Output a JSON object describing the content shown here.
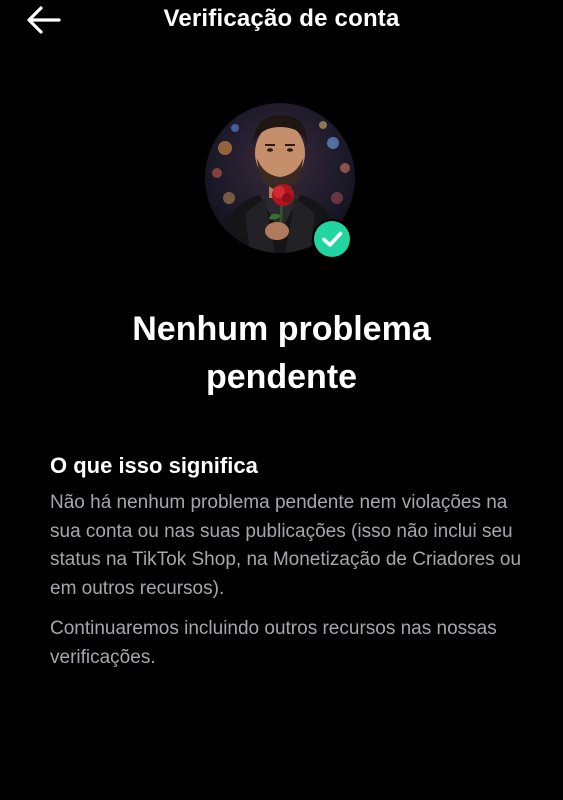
{
  "header": {
    "title": "Verificação de conta",
    "back_icon": "arrow-left-icon"
  },
  "status": {
    "badge_icon": "check-icon",
    "badge_color": "#20d5a0",
    "headline_line1": "Nenhum problema",
    "headline_line2": "pendente"
  },
  "info": {
    "title": "O que isso significa",
    "paragraph1": "Não há nenhum problema pendente nem violações na sua conta ou nas suas publicações (isso não inclui seu status na TikTok Shop, na Monetização de Criadores ou em outros recursos).",
    "paragraph2": "Continuaremos incluindo outros recursos nas nossas verificações."
  },
  "colors": {
    "background": "#000000",
    "text_primary": "#ffffff",
    "text_secondary": "#a7a7ab",
    "accent": "#20d5a0"
  }
}
